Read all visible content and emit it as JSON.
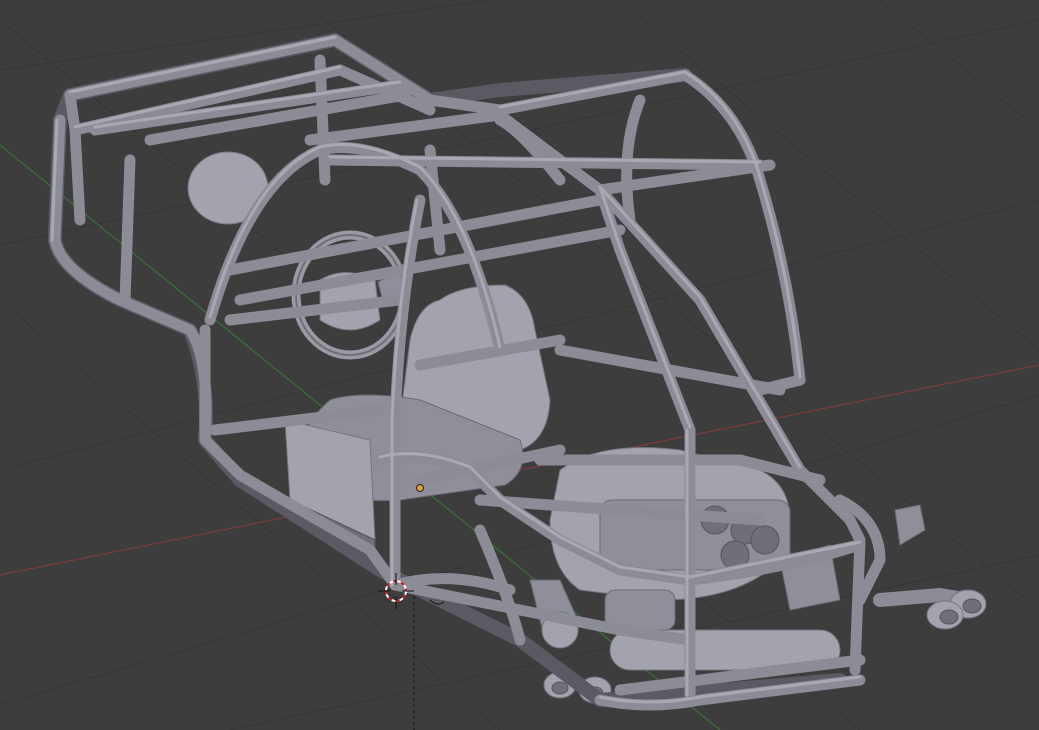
{
  "viewport": {
    "background": "#3d3d3d",
    "grid_color": "#363636",
    "x_axis_color": "#8a3a3a",
    "y_axis_color": "#3a7a3a",
    "model_color": "#8c8c96",
    "model_highlight": "#a9a9b3"
  },
  "objects": {
    "model": "roll-cage-buggy",
    "cursor": "3d-cursor-icon",
    "origin": "object-origin-dot"
  }
}
